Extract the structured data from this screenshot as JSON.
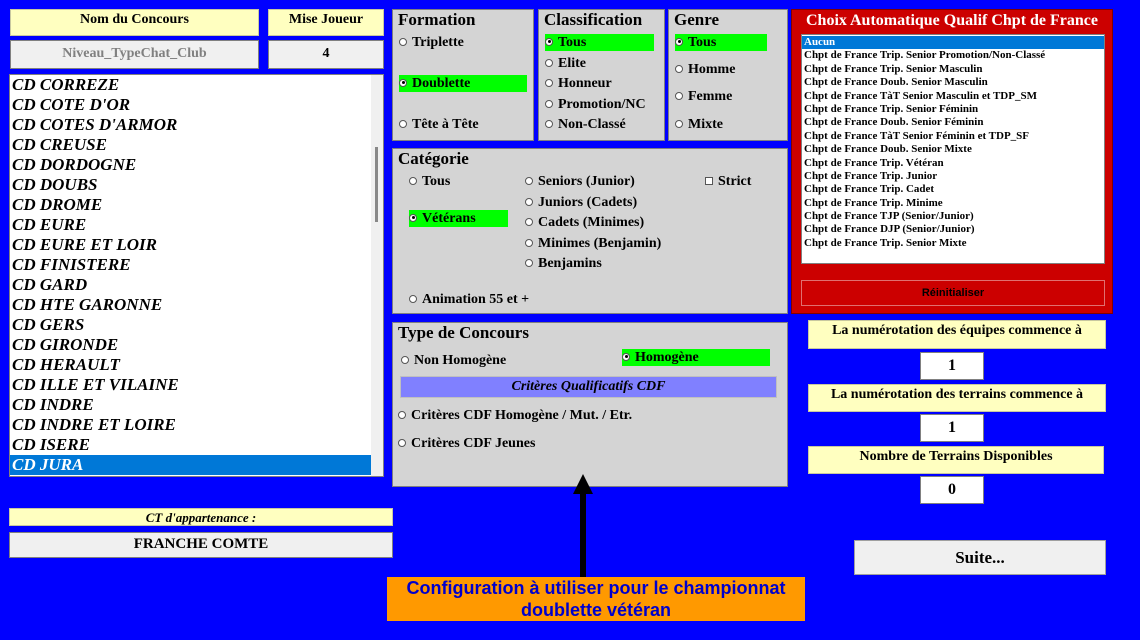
{
  "header": {
    "concours_label": "Nom du Concours",
    "mise_label": "Mise Joueur",
    "concours_value": "Niveau_TypeChat_Club",
    "mise_value": "4"
  },
  "cd_list": {
    "items": [
      {
        "label": "CD CORREZE"
      },
      {
        "label": "CD COTE D'OR"
      },
      {
        "label": "CD COTES D'ARMOR"
      },
      {
        "label": "CD CREUSE"
      },
      {
        "label": "CD DORDOGNE"
      },
      {
        "label": "CD DOUBS"
      },
      {
        "label": "CD DROME"
      },
      {
        "label": "CD EURE"
      },
      {
        "label": "CD EURE ET LOIR"
      },
      {
        "label": "CD FINISTERE"
      },
      {
        "label": "CD GARD"
      },
      {
        "label": "CD HTE GARONNE"
      },
      {
        "label": "CD GERS"
      },
      {
        "label": "CD GIRONDE"
      },
      {
        "label": "CD HERAULT"
      },
      {
        "label": "CD ILLE ET VILAINE"
      },
      {
        "label": "CD INDRE"
      },
      {
        "label": "CD INDRE ET LOIRE"
      },
      {
        "label": "CD ISERE"
      },
      {
        "label": "CD JURA"
      }
    ],
    "selected_index": 19
  },
  "ct": {
    "label": "CT d'appartenance :",
    "value": "FRANCHE COMTE"
  },
  "formation": {
    "title": "Formation",
    "options": [
      {
        "label": "Triplette"
      },
      {
        "label": "Doublette"
      },
      {
        "label": "Tête à Tête"
      }
    ],
    "selected": "Doublette"
  },
  "classification": {
    "title": "Classification",
    "options": [
      {
        "label": "Tous"
      },
      {
        "label": "Elite"
      },
      {
        "label": "Honneur"
      },
      {
        "label": "Promotion/NC"
      },
      {
        "label": "Non-Classé"
      }
    ],
    "selected": "Tous"
  },
  "genre": {
    "title": "Genre",
    "options": [
      {
        "label": "Tous"
      },
      {
        "label": "Homme"
      },
      {
        "label": "Femme"
      },
      {
        "label": "Mixte"
      }
    ],
    "selected": "Tous"
  },
  "categorie": {
    "title": "Catégorie",
    "options": [
      {
        "label": "Tous"
      },
      {
        "label": "Vétérans"
      },
      {
        "label": "Animation 55 et +"
      },
      {
        "label": "Seniors (Junior)"
      },
      {
        "label": "Juniors (Cadets)"
      },
      {
        "label": "Cadets (Minimes)"
      },
      {
        "label": "Minimes (Benjamin)"
      },
      {
        "label": "Benjamins"
      }
    ],
    "selected": "Vétérans",
    "strict_label": "Strict"
  },
  "type_concours": {
    "title": "Type de Concours",
    "non_homogene": "Non Homogène",
    "homogene": "Homogène",
    "selected": "Homogène",
    "criteres_header": "Critères Qualificatifs CDF",
    "crit1": "Critères CDF Homogène / Mut. / Etr.",
    "crit2": "Critères CDF Jeunes"
  },
  "qualif": {
    "title": "Choix Automatique Qualif Chpt de France",
    "items": [
      {
        "label": "Aucun"
      },
      {
        "label": "Chpt de France Trip. Senior Promotion/Non-Classé"
      },
      {
        "label": "Chpt de France Trip. Senior Masculin"
      },
      {
        "label": "Chpt de France Doub. Senior Masculin"
      },
      {
        "label": "Chpt de France TàT Senior Masculin et TDP_SM"
      },
      {
        "label": "Chpt de France Trip. Senior Féminin"
      },
      {
        "label": "Chpt de France Doub. Senior Féminin"
      },
      {
        "label": "Chpt de France TàT Senior Féminin et TDP_SF"
      },
      {
        "label": "Chpt de France Doub. Senior Mixte"
      },
      {
        "label": "Chpt de France Trip. Vétéran"
      },
      {
        "label": "Chpt de France Trip. Junior"
      },
      {
        "label": "Chpt de France Trip. Cadet"
      },
      {
        "label": "Chpt de France Trip. Minime"
      },
      {
        "label": "Chpt de France TJP (Senior/Junior)"
      },
      {
        "label": "Chpt de France DJP (Senior/Junior)"
      },
      {
        "label": "Chpt de France Trip. Senior Mixte"
      }
    ],
    "selected_index": 0,
    "reset_label": "Réinitialiser"
  },
  "numbering": {
    "equipes_label": "La numérotation des équipes commence à",
    "equipes_value": "1",
    "terrains_label": "La numérotation des terrains commence à",
    "terrains_value": "1",
    "nb_terrains_label": "Nombre de Terrains Disponibles",
    "nb_terrains_value": "0"
  },
  "suite_label": "Suite...",
  "annotation": "Configuration à utiliser pour le championnat doublette vétéran",
  "colors": {
    "background": "#0000ff",
    "selected_option": "#00ff00",
    "qualif_frame": "#cc0000",
    "annotation_bg": "#ff9900",
    "criteres_bg": "#8080ff"
  }
}
